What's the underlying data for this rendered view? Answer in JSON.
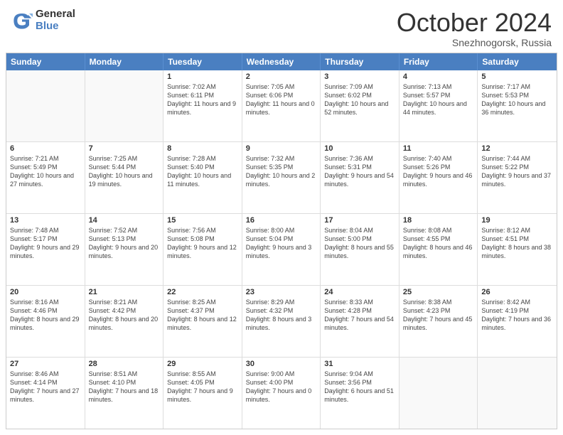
{
  "header": {
    "logo_general": "General",
    "logo_blue": "Blue",
    "month_title": "October 2024",
    "location": "Snezhnogorsk, Russia"
  },
  "calendar": {
    "days_of_week": [
      "Sunday",
      "Monday",
      "Tuesday",
      "Wednesday",
      "Thursday",
      "Friday",
      "Saturday"
    ],
    "weeks": [
      [
        {
          "day": "",
          "detail": "",
          "empty": true
        },
        {
          "day": "",
          "detail": "",
          "empty": true
        },
        {
          "day": "1",
          "detail": "Sunrise: 7:02 AM\nSunset: 6:11 PM\nDaylight: 11 hours\nand 9 minutes."
        },
        {
          "day": "2",
          "detail": "Sunrise: 7:05 AM\nSunset: 6:06 PM\nDaylight: 11 hours\nand 0 minutes."
        },
        {
          "day": "3",
          "detail": "Sunrise: 7:09 AM\nSunset: 6:02 PM\nDaylight: 10 hours\nand 52 minutes."
        },
        {
          "day": "4",
          "detail": "Sunrise: 7:13 AM\nSunset: 5:57 PM\nDaylight: 10 hours\nand 44 minutes."
        },
        {
          "day": "5",
          "detail": "Sunrise: 7:17 AM\nSunset: 5:53 PM\nDaylight: 10 hours\nand 36 minutes."
        }
      ],
      [
        {
          "day": "6",
          "detail": "Sunrise: 7:21 AM\nSunset: 5:49 PM\nDaylight: 10 hours\nand 27 minutes."
        },
        {
          "day": "7",
          "detail": "Sunrise: 7:25 AM\nSunset: 5:44 PM\nDaylight: 10 hours\nand 19 minutes."
        },
        {
          "day": "8",
          "detail": "Sunrise: 7:28 AM\nSunset: 5:40 PM\nDaylight: 10 hours\nand 11 minutes."
        },
        {
          "day": "9",
          "detail": "Sunrise: 7:32 AM\nSunset: 5:35 PM\nDaylight: 10 hours\nand 2 minutes."
        },
        {
          "day": "10",
          "detail": "Sunrise: 7:36 AM\nSunset: 5:31 PM\nDaylight: 9 hours\nand 54 minutes."
        },
        {
          "day": "11",
          "detail": "Sunrise: 7:40 AM\nSunset: 5:26 PM\nDaylight: 9 hours\nand 46 minutes."
        },
        {
          "day": "12",
          "detail": "Sunrise: 7:44 AM\nSunset: 5:22 PM\nDaylight: 9 hours\nand 37 minutes."
        }
      ],
      [
        {
          "day": "13",
          "detail": "Sunrise: 7:48 AM\nSunset: 5:17 PM\nDaylight: 9 hours\nand 29 minutes."
        },
        {
          "day": "14",
          "detail": "Sunrise: 7:52 AM\nSunset: 5:13 PM\nDaylight: 9 hours\nand 20 minutes."
        },
        {
          "day": "15",
          "detail": "Sunrise: 7:56 AM\nSunset: 5:08 PM\nDaylight: 9 hours\nand 12 minutes."
        },
        {
          "day": "16",
          "detail": "Sunrise: 8:00 AM\nSunset: 5:04 PM\nDaylight: 9 hours\nand 3 minutes."
        },
        {
          "day": "17",
          "detail": "Sunrise: 8:04 AM\nSunset: 5:00 PM\nDaylight: 8 hours\nand 55 minutes."
        },
        {
          "day": "18",
          "detail": "Sunrise: 8:08 AM\nSunset: 4:55 PM\nDaylight: 8 hours\nand 46 minutes."
        },
        {
          "day": "19",
          "detail": "Sunrise: 8:12 AM\nSunset: 4:51 PM\nDaylight: 8 hours\nand 38 minutes."
        }
      ],
      [
        {
          "day": "20",
          "detail": "Sunrise: 8:16 AM\nSunset: 4:46 PM\nDaylight: 8 hours\nand 29 minutes."
        },
        {
          "day": "21",
          "detail": "Sunrise: 8:21 AM\nSunset: 4:42 PM\nDaylight: 8 hours\nand 20 minutes."
        },
        {
          "day": "22",
          "detail": "Sunrise: 8:25 AM\nSunset: 4:37 PM\nDaylight: 8 hours\nand 12 minutes."
        },
        {
          "day": "23",
          "detail": "Sunrise: 8:29 AM\nSunset: 4:32 PM\nDaylight: 8 hours\nand 3 minutes."
        },
        {
          "day": "24",
          "detail": "Sunrise: 8:33 AM\nSunset: 4:28 PM\nDaylight: 7 hours\nand 54 minutes."
        },
        {
          "day": "25",
          "detail": "Sunrise: 8:38 AM\nSunset: 4:23 PM\nDaylight: 7 hours\nand 45 minutes."
        },
        {
          "day": "26",
          "detail": "Sunrise: 8:42 AM\nSunset: 4:19 PM\nDaylight: 7 hours\nand 36 minutes."
        }
      ],
      [
        {
          "day": "27",
          "detail": "Sunrise: 8:46 AM\nSunset: 4:14 PM\nDaylight: 7 hours\nand 27 minutes."
        },
        {
          "day": "28",
          "detail": "Sunrise: 8:51 AM\nSunset: 4:10 PM\nDaylight: 7 hours\nand 18 minutes."
        },
        {
          "day": "29",
          "detail": "Sunrise: 8:55 AM\nSunset: 4:05 PM\nDaylight: 7 hours\nand 9 minutes."
        },
        {
          "day": "30",
          "detail": "Sunrise: 9:00 AM\nSunset: 4:00 PM\nDaylight: 7 hours\nand 0 minutes."
        },
        {
          "day": "31",
          "detail": "Sunrise: 9:04 AM\nSunset: 3:56 PM\nDaylight: 6 hours\nand 51 minutes."
        },
        {
          "day": "",
          "detail": "",
          "empty": true
        },
        {
          "day": "",
          "detail": "",
          "empty": true
        }
      ]
    ]
  }
}
